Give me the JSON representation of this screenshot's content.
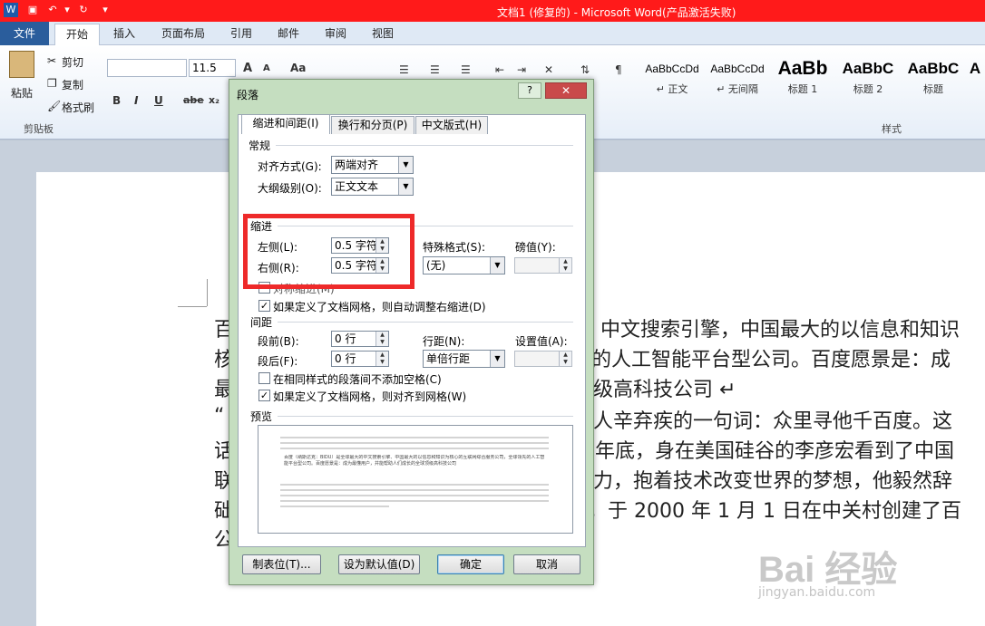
{
  "window": {
    "title": "文档1 (修复的) - Microsoft Word(产品激活失败)"
  },
  "ribbon_tabs": [
    "文件",
    "开始",
    "插入",
    "页面布局",
    "引用",
    "邮件",
    "审阅",
    "视图"
  ],
  "clipboard": {
    "paste": "粘贴",
    "cut": "剪切",
    "copy": "复制",
    "format_painter": "格式刷",
    "group": "剪贴板"
  },
  "font": {
    "name": "",
    "size": "11.5",
    "bold": "B",
    "italic": "I",
    "underline": "U",
    "strike": "abe",
    "sub": "x₂",
    "grow": "A",
    "shrink": "A",
    "case": "Aa"
  },
  "styles": {
    "group": "样式",
    "items": [
      {
        "sample": "AaBbCcDd",
        "name": "↵ 正文"
      },
      {
        "sample": "AaBbCcDd",
        "name": "↵ 无间隔"
      },
      {
        "sample": "AaBb",
        "name": "标题 1"
      },
      {
        "sample": "AaBbC",
        "name": "标题 2"
      },
      {
        "sample": "AaBbC",
        "name": "标题"
      },
      {
        "sample": "A",
        "name": ""
      }
    ]
  },
  "document": {
    "left_chars": [
      "百",
      "核",
      "最",
      "“",
      "话",
      "联",
      "础",
      "公"
    ],
    "right_lines": [
      "中文搜索引擎，中国最大的以信息和知识",
      "的人工智能平台型公司。百度愿景是：成",
      "级高科技公司 ↵",
      "人辛弃疾的一句词：众里寻他千百度。这",
      "年底，身在美国硅谷的李彦宏看到了中国",
      "力，抱着技术改变世界的梦想，他毅然辞",
      "，于 2000 年 1 月 1 日在中关村创建了百"
    ]
  },
  "watermark": {
    "logo": "Bai 经验",
    "url": "jingyan.baidu.com"
  },
  "dialog": {
    "title": "段落",
    "help": "?",
    "close": "✕",
    "tabs": [
      "缩进和间距(I)",
      "换行和分页(P)",
      "中文版式(H)"
    ],
    "general": {
      "title": "常规",
      "alignment_label": "对齐方式(G):",
      "alignment_value": "两端对齐",
      "outline_label": "大纲级别(O):",
      "outline_value": "正文文本"
    },
    "indent": {
      "title": "缩进",
      "left_label": "左侧(L):",
      "left_value": "0.5 字符",
      "right_label": "右侧(R):",
      "right_value": "0.5 字符",
      "special_label": "特殊格式(S):",
      "special_value": "(无)",
      "by_label": "磅值(Y):",
      "by_value": "",
      "mirror_label": "对称缩进(M)",
      "auto_adjust_label": "如果定义了文档网格，则自动调整右缩进(D)"
    },
    "spacing": {
      "title": "间距",
      "before_label": "段前(B):",
      "before_value": "0 行",
      "after_label": "段后(F):",
      "after_value": "0 行",
      "line_label": "行距(N):",
      "line_value": "单倍行距",
      "at_label": "设置值(A):",
      "at_value": "",
      "no_space_label": "在相同样式的段落间不添加空格(C)",
      "snap_grid_label": "如果定义了文档网格，则对齐到网格(W)"
    },
    "preview": {
      "title": "预览",
      "sample_text": "百度（纳斯达克：BIDU）是全球最大的中文搜索引擎、中国最大的以信息和知识为核心的互联网综合服务公司，全球领先的人工智能平台型公司。百度愿景是：成为最懂用户，并能帮助人们成长的全球顶级高科技公司"
    },
    "buttons": {
      "tabs": "制表位(T)...",
      "default": "设为默认值(D)",
      "ok": "确定",
      "cancel": "取消"
    }
  }
}
